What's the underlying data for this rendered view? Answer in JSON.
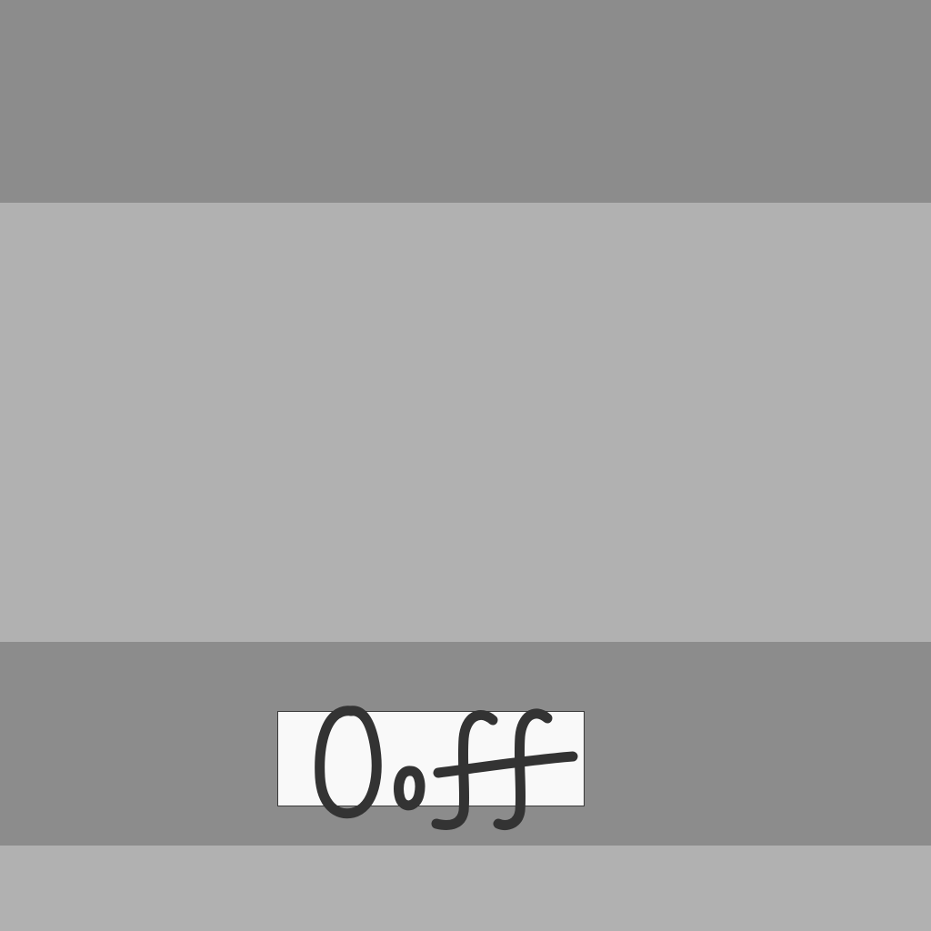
{
  "label": {
    "text": "Ooff",
    "ink_color": "#333333",
    "box_color": "#f9f9f9"
  },
  "colors": {
    "dark_band": "#8c8c8c",
    "light_band": "#b1b1b1"
  }
}
